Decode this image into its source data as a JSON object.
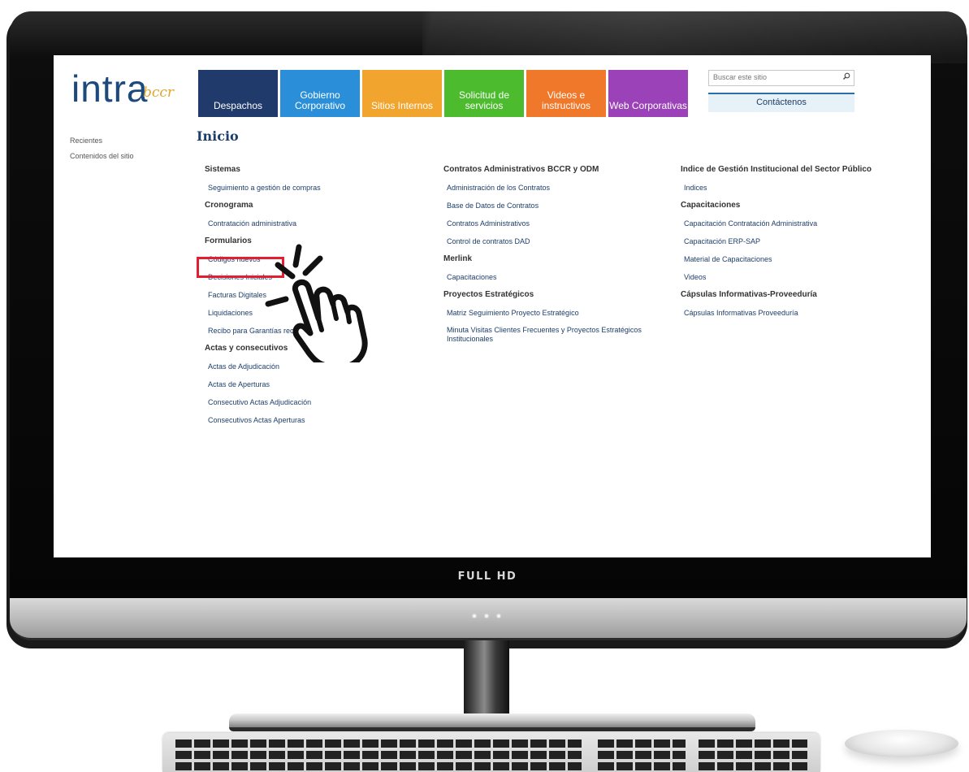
{
  "device": {
    "badge": "FULL HD"
  },
  "site": {
    "logo_main": "intra",
    "logo_sub": "bccr",
    "tiles": [
      {
        "label": "Despachos",
        "color": "#1f3a6b"
      },
      {
        "label": "Gobierno Corporativo",
        "color": "#2a8fd8"
      },
      {
        "label": "Sitios Internos",
        "color": "#f2a52e"
      },
      {
        "label": "Solicitud de servicios",
        "color": "#4dbb2e"
      },
      {
        "label": "Videos e instructivos",
        "color": "#f0782a"
      },
      {
        "label": "Web Corporativas",
        "color": "#9c42b8"
      }
    ],
    "search_placeholder": "Buscar este sitio",
    "contact_label": "Contáctenos",
    "left_nav": [
      "Recientes",
      "Contenidos del sitio"
    ],
    "page_title": "Inicio"
  },
  "columns": [
    [
      {
        "type": "h",
        "text": "Sistemas"
      },
      {
        "type": "l",
        "text": "Seguimiento a gestión de compras"
      },
      {
        "type": "h",
        "text": "Cronograma"
      },
      {
        "type": "l",
        "text": "Contratación administrativa"
      },
      {
        "type": "h",
        "text": "Formularios"
      },
      {
        "type": "l",
        "text": "Códigos nuevos"
      },
      {
        "type": "l",
        "text": "Decisiones Iniciales"
      },
      {
        "type": "l",
        "text": "Facturas Digitales"
      },
      {
        "type": "l",
        "text": "Liquidaciones"
      },
      {
        "type": "l",
        "text": "Recibo para Garantías recibidas en Efectivo"
      },
      {
        "type": "h",
        "text": "Actas y consecutivos"
      },
      {
        "type": "l",
        "text": "Actas de Adjudicación"
      },
      {
        "type": "l",
        "text": "Actas de Aperturas"
      },
      {
        "type": "l",
        "text": "Consecutivo Actas Adjudicación"
      },
      {
        "type": "l",
        "text": "Consecutivos Actas Aperturas"
      }
    ],
    [
      {
        "type": "h",
        "text": "Contratos Administrativos BCCR y ODM"
      },
      {
        "type": "l",
        "text": "Administración de los Contratos"
      },
      {
        "type": "l",
        "text": "Base de Datos de Contratos"
      },
      {
        "type": "l",
        "text": "Contratos Administrativos"
      },
      {
        "type": "l",
        "text": "Control de contratos DAD"
      },
      {
        "type": "h",
        "text": "Merlink"
      },
      {
        "type": "l",
        "text": "Capacitaciones"
      },
      {
        "type": "h",
        "text": "Proyectos Estratégicos"
      },
      {
        "type": "l",
        "text": "Matriz Seguimiento Proyecto Estratégico"
      },
      {
        "type": "l2",
        "text": "Minuta Visitas Clientes Frecuentes y Proyectos Estratégicos Institucionales"
      }
    ],
    [
      {
        "type": "h",
        "text": "Indice de Gestión Institucional del Sector Público"
      },
      {
        "type": "l",
        "text": "Indices"
      },
      {
        "type": "h",
        "text": "Capacitaciones"
      },
      {
        "type": "l",
        "text": "Capacitación Contratación Administrativa"
      },
      {
        "type": "l",
        "text": "Capacitación ERP-SAP"
      },
      {
        "type": "l",
        "text": "Material de Capacitaciones"
      },
      {
        "type": "l",
        "text": "Videos"
      },
      {
        "type": "h",
        "text": "Cápsulas Informativas-Proveeduría"
      },
      {
        "type": "l",
        "text": "Cápsulas Informativas Proveeduría"
      }
    ]
  ],
  "colors": {
    "highlight": "#e02030",
    "link": "#1d3e6b"
  },
  "icons": {
    "search": "search-icon",
    "pointer": "hand-pointer-icon"
  }
}
